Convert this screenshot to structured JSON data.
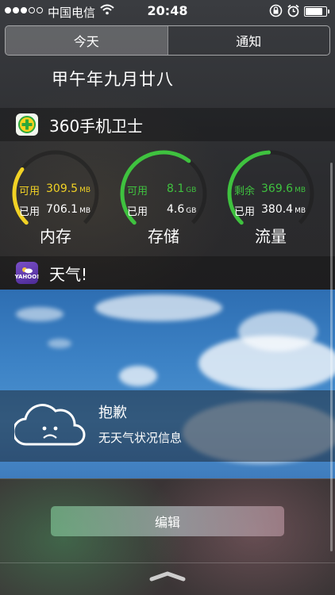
{
  "status_bar": {
    "carrier": "中国电信",
    "time": "20:48",
    "signal_bars_filled": 3,
    "signal_bars_total": 5,
    "battery_level": 0.85
  },
  "segments": {
    "today": "今天",
    "notifications": "通知",
    "active": "today"
  },
  "date_text": "甲午年九月廿八",
  "widget_360": {
    "title": "360手机卫士",
    "gauges": [
      {
        "title": "内存",
        "row1_label": "可用",
        "row1_value": "309.5",
        "row1_unit": "MB",
        "row2_label": "已用",
        "row2_value": "706.1",
        "row2_unit": "MB",
        "color": "#f1d225",
        "fill": 0.3
      },
      {
        "title": "存储",
        "row1_label": "可用",
        "row1_value": "8.1",
        "row1_unit": "GB",
        "row2_label": "已用",
        "row2_value": "4.6",
        "row2_unit": "GB",
        "color": "#3fc23f",
        "fill": 0.64
      },
      {
        "title": "流量",
        "row1_label": "剩余",
        "row1_value": "369.6",
        "row1_unit": "MB",
        "row2_label": "已用",
        "row2_value": "380.4",
        "row2_unit": "MB",
        "color": "#3fc23f",
        "fill": 0.49
      }
    ]
  },
  "widget_weather": {
    "title": "天气!",
    "icon_label": "YAHOO!",
    "message_title": "抱歉",
    "message_sub": "无天气状况信息"
  },
  "edit_button": "编辑",
  "colors": {
    "yellow": "#f1d225",
    "green": "#3fc23f",
    "sky": "#3d83c6"
  },
  "icons": [
    "wifi-icon",
    "orientation-lock-icon",
    "alarm-icon",
    "battery-icon",
    "360-shield-icon",
    "yahoo-weather-icon",
    "sad-cloud-icon",
    "pull-handle-icon"
  ]
}
